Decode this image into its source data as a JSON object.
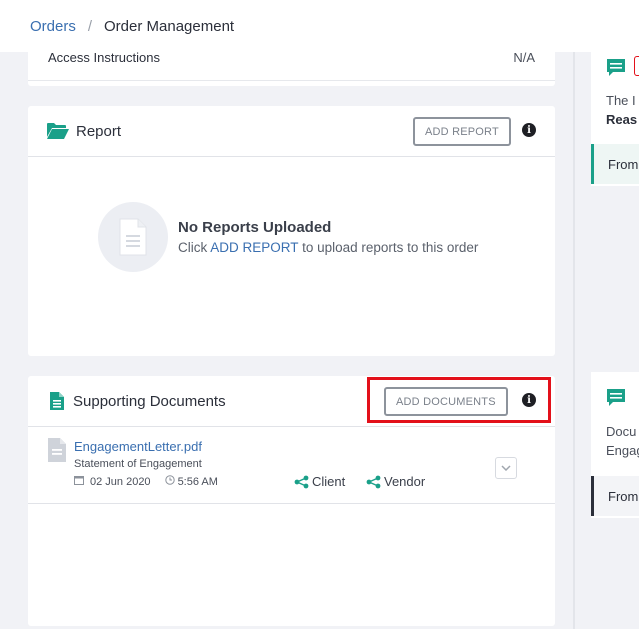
{
  "breadcrumb": {
    "parent": "Orders",
    "separator": "/",
    "current": "Order Management"
  },
  "access": {
    "label": "Access Instructions",
    "value": "N/A"
  },
  "report": {
    "title": "Report",
    "add_button": "ADD REPORT",
    "empty_title": "No Reports Uploaded",
    "empty_prefix": "Click",
    "empty_link": "ADD REPORT",
    "empty_suffix": "to upload reports to this order"
  },
  "documents": {
    "title": "Supporting Documents",
    "add_button": "ADD DOCUMENTS",
    "items": [
      {
        "name": "EngagementLetter.pdf",
        "description": "Statement of Engagement",
        "date": "02 Jun 2020",
        "time": "5:56 AM",
        "shared_with": [
          "Client",
          "Vendor"
        ]
      }
    ]
  },
  "messages": [
    {
      "line1": "The I",
      "line2": "Reas",
      "from": "From:"
    },
    {
      "line1": "Docu",
      "line2": "Engag",
      "from": "From:"
    }
  ],
  "colors": {
    "accent": "#1aa089",
    "link": "#3a6fb0",
    "highlight": "#e3101a"
  },
  "icons": [
    "folder-open-icon",
    "file-text-icon",
    "info-icon",
    "calendar-icon",
    "clock-icon",
    "share-icon",
    "chevron-down-icon",
    "comment-icon"
  ]
}
